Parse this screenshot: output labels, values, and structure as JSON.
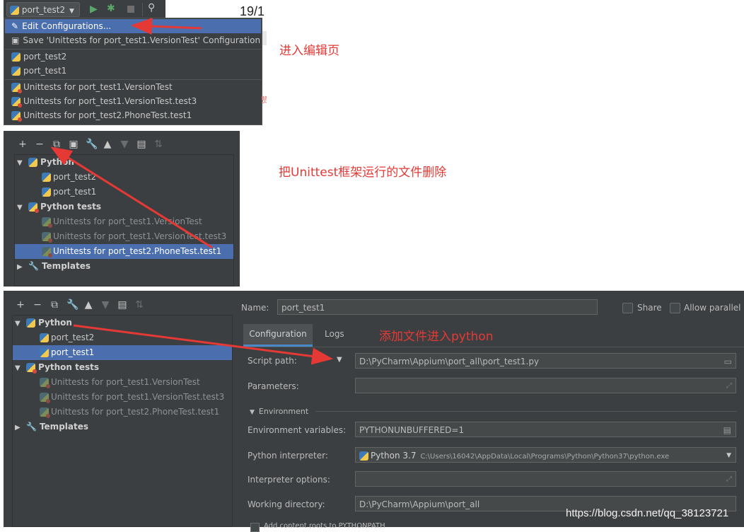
{
  "panel1": {
    "run_config": "port_test2",
    "date_fragment": "19/1",
    "menu": {
      "edit_configurations": "Edit Configurations...",
      "save_config": "Save 'Unittests for port_test1.VersionTest' Configuration",
      "items": [
        "port_test2",
        "port_test1"
      ],
      "unittests": [
        "Unittests for port_test1.VersionTest",
        "Unittests for port_test1.VersionTest.test3",
        "Unittests for port_test2.PhoneTest.test1"
      ]
    },
    "side_fragment": "赞",
    "annotation": "进入编辑页"
  },
  "panel2": {
    "tree": {
      "python": "Python",
      "python_items": [
        "port_test2",
        "port_test1"
      ],
      "python_tests": "Python tests",
      "unittests": [
        "Unittests for port_test1.VersionTest",
        "Unittests for port_test1.VersionTest.test3",
        "Unittests for port_test2.PhoneTest.test1"
      ],
      "templates": "Templates"
    },
    "annotation": "把Unittest框架运行的文件删除"
  },
  "panel3": {
    "tree": {
      "python": "Python",
      "python_items": [
        "port_test2",
        "port_test1"
      ],
      "python_tests": "Python tests",
      "unittests": [
        "Unittests for port_test1.VersionTest",
        "Unittests for port_test1.VersionTest.test3",
        "Unittests for port_test2.PhoneTest.test1"
      ],
      "templates": "Templates"
    },
    "name_label": "Name:",
    "name_value": "port_test1",
    "share_label": "Share",
    "parallel_label": "Allow parallel r",
    "tabs": [
      "Configuration",
      "Logs"
    ],
    "annotation": "添加文件进入python",
    "script_path_label": "Script path:",
    "script_path_value": "D:\\PyCharm\\Appium\\port_all\\port_test1.py",
    "parameters_label": "Parameters:",
    "environment_label": "Environment",
    "env_vars_label": "Environment variables:",
    "env_vars_value": "PYTHONUNBUFFERED=1",
    "interpreter_label": "Python interpreter:",
    "interpreter_name": "Python 3.7",
    "interpreter_path": "C:\\Users\\16042\\AppData\\Local\\Programs\\Python\\Python37\\python.exe",
    "interp_options_label": "Interpreter options:",
    "working_dir_label": "Working directory:",
    "working_dir_value": "D:\\PyCharm\\Appium\\port_all",
    "bottom_fragment": "Add content roots to PYTHONPATH"
  },
  "watermark": "https://blog.csdn.net/qq_38123721",
  "colors": {
    "selection": "#4b6eaf",
    "panel_bg": "#3c3f41",
    "annotation_red": "#e53935",
    "arrow_red": "#e53935"
  }
}
